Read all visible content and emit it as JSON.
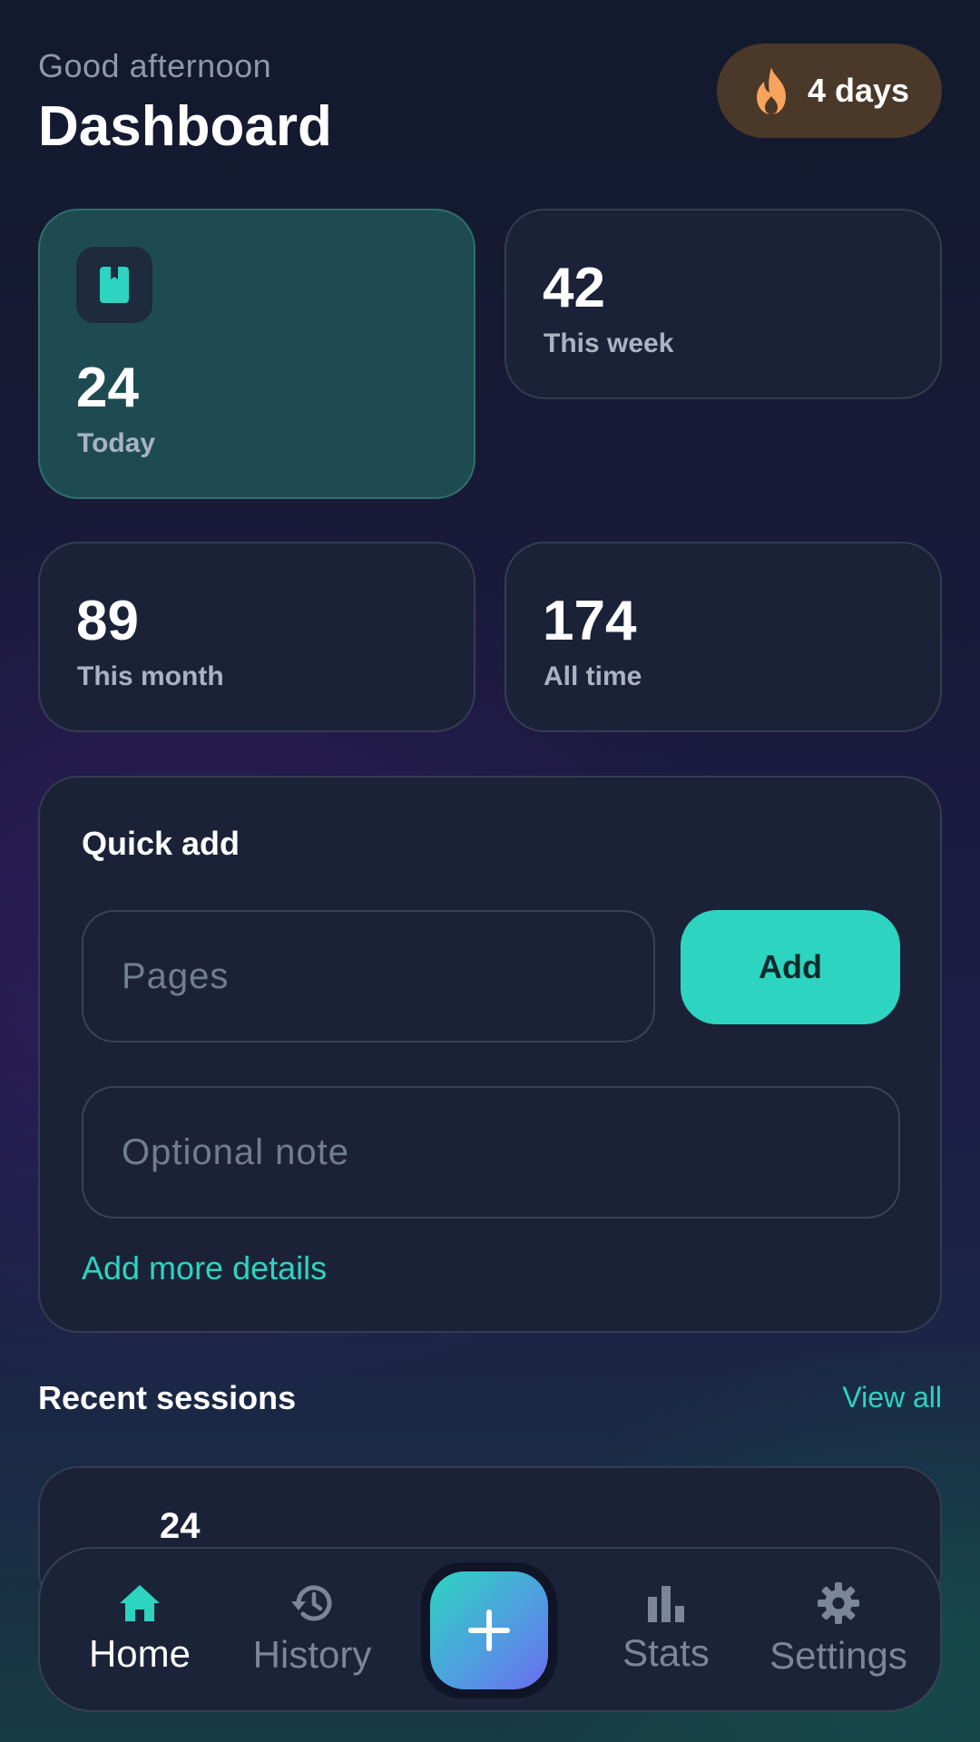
{
  "header": {
    "greeting": "Good afternoon",
    "title": "Dashboard",
    "streak": {
      "icon": "fire-icon",
      "label": "4 days"
    }
  },
  "stats": [
    {
      "value": "24",
      "label": "Today",
      "icon": "book-icon",
      "highlighted": true
    },
    {
      "value": "42",
      "label": "This week"
    },
    {
      "value": "89",
      "label": "This month"
    },
    {
      "value": "174",
      "label": "All time"
    }
  ],
  "quick_add": {
    "title": "Quick add",
    "pages_placeholder": "Pages",
    "pages_value": "",
    "note_placeholder": "Optional note",
    "note_value": "",
    "add_label": "Add",
    "more_details_label": "Add more details"
  },
  "recent": {
    "title": "Recent sessions",
    "view_all_label": "View all",
    "first_session_peek": "24"
  },
  "nav": {
    "items": [
      {
        "label": "Home",
        "icon": "home-icon",
        "active": true
      },
      {
        "label": "History",
        "icon": "history-icon"
      },
      {
        "label": "",
        "icon": "plus-icon"
      },
      {
        "label": "Stats",
        "icon": "bar-chart-icon"
      },
      {
        "label": "Settings",
        "icon": "gear-icon"
      }
    ]
  },
  "colors": {
    "accent": "#2dd4bf",
    "card": "#1b2238",
    "highlight_card": "#1e4b51",
    "streak_bg": "#4a3829",
    "fire": "#f7a35c",
    "muted_text": "#8e98ad"
  }
}
